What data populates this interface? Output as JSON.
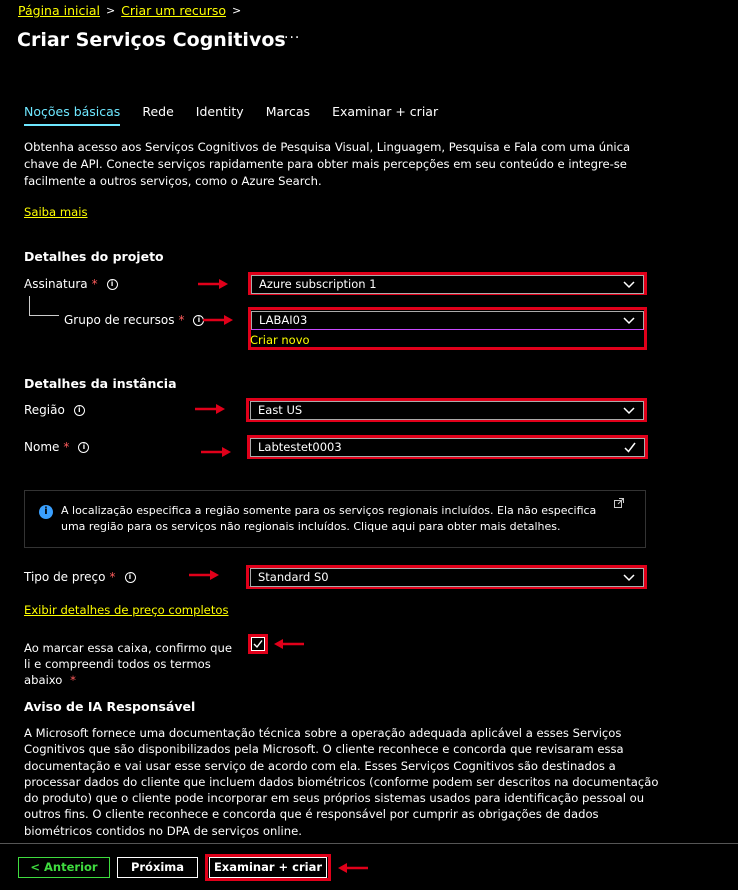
{
  "breadcrumb": {
    "home": "Página inicial",
    "create": "Criar um recurso"
  },
  "page_title": "Criar Serviços Cognitivos",
  "more_label": "···",
  "tabs": [
    {
      "label": "Noções básicas",
      "active": true
    },
    {
      "label": "Rede"
    },
    {
      "label": "Identity"
    },
    {
      "label": "Marcas"
    },
    {
      "label": "Examinar + criar"
    }
  ],
  "description": "Obtenha acesso aos Serviços Cognitivos de Pesquisa Visual, Linguagem, Pesquisa e Fala com uma única chave de API. Conecte serviços rapidamente para obter mais percepções em seu conteúdo e integre-se facilmente a outros serviços, como o Azure Search.",
  "learn_more": "Saiba mais",
  "project": {
    "heading": "Detalhes do projeto",
    "subscription_label": "Assinatura",
    "subscription_value": "Azure subscription 1",
    "rg_label": "Grupo de recursos",
    "rg_value": "LABAI03",
    "create_new": "Criar novo"
  },
  "instance": {
    "heading": "Detalhes da instância",
    "region_label": "Região",
    "region_value": "East US",
    "name_label": "Nome",
    "name_value": "Labtestet0003"
  },
  "required_mark": "*",
  "info_glyph": "i",
  "note": {
    "icon": "i",
    "text": "A localização especifica a região somente para os serviços regionais incluídos. Ela não especifica uma região para os serviços não regionais incluídos. Clique aqui para obter mais detalhes."
  },
  "pricing": {
    "label": "Tipo de preço",
    "value": "Standard S0",
    "details_link": "Exibir detalhes de preço completos"
  },
  "terms": {
    "label": "Ao marcar essa caixa, confirmo que li e compreendi todos os termos abaixo",
    "checked": true
  },
  "ai_notice": {
    "heading": "Aviso de IA Responsável",
    "text": "A Microsoft fornece uma documentação técnica sobre a operação adequada aplicável a esses Serviços Cognitivos que são disponibilizados pela Microsoft. O cliente reconhece e concorda que revisaram essa documentação e vai usar esse serviço de acordo com ela. Esses Serviços Cognitivos são destinados a processar dados do cliente que incluem dados biométricos (conforme podem ser descritos na documentação do produto) que o cliente pode incorporar em seus próprios sistemas usados para identificação pessoal ou outros fins. O cliente reconhece e concorda que é responsável por cumprir as obrigações de dados biométricos contidos no DPA de serviços online."
  },
  "footer": {
    "prev": "< Anterior",
    "next": "Próxima",
    "review": "Examinar + criar"
  },
  "colors": {
    "accent": "#6ee7ff",
    "link": "#ffff00",
    "highlight": "#e0001a",
    "required": "#ff5c5c"
  }
}
